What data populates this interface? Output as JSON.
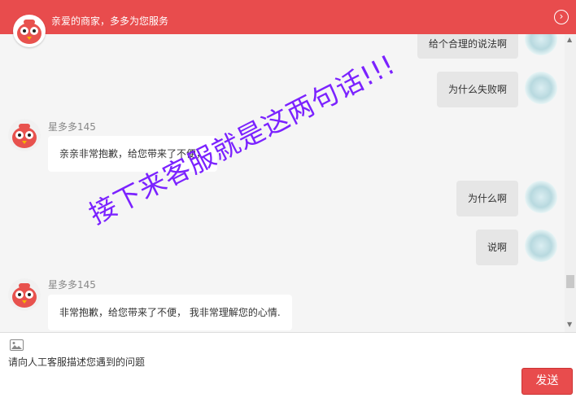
{
  "header": {
    "title": "亲爱的商家，多多为您服务",
    "collapse_icon": "chevron-right-circle-icon"
  },
  "messages": [
    {
      "side": "right",
      "text": "给个合理的说法啊"
    },
    {
      "side": "right",
      "text": "为什么失败啊"
    },
    {
      "side": "left",
      "sender": "星多多145",
      "text": "亲亲非常抱歉，给您带来了不便，"
    },
    {
      "side": "right",
      "text": "为什么啊"
    },
    {
      "side": "right",
      "text": "说啊"
    },
    {
      "side": "left",
      "sender": "星多多145",
      "text": "非常抱歉，给您带来了不便， 我非常理解您的心情."
    }
  ],
  "watermark": "接下来客服就是这两句话!!!",
  "input": {
    "image_icon": "image-icon",
    "placeholder": "请向人工客服描述您遇到的问题",
    "value": ""
  },
  "send_button": {
    "label": "发送"
  },
  "colors": {
    "brand": "#e84c4d",
    "watermark": "#7b22ff"
  }
}
